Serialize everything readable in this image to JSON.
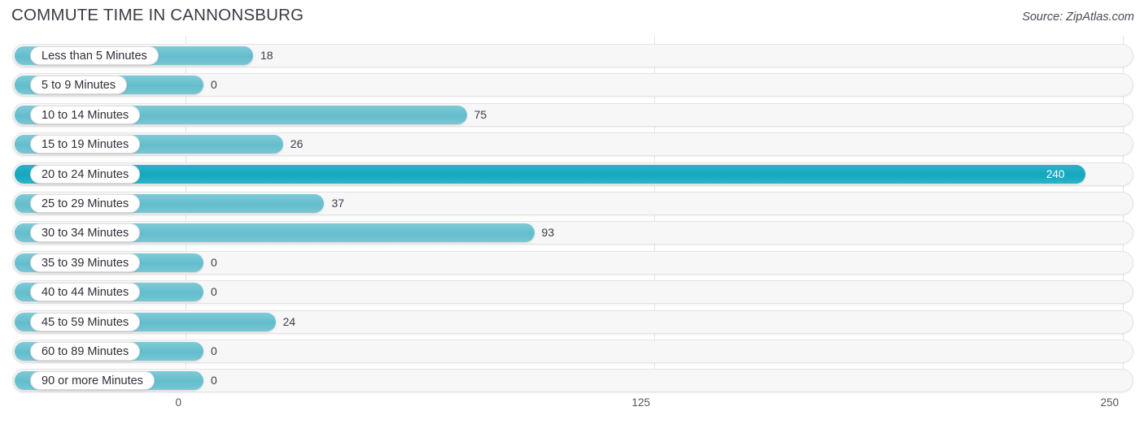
{
  "header": {
    "title": "COMMUTE TIME IN CANNONSBURG",
    "source": "Source: ZipAtlas.com"
  },
  "colors": {
    "bar": "#63bdcd",
    "bar_highlight": "#17a6be",
    "track": "#f7f7f8",
    "grid": "#e3e3e6",
    "text": "#3b3b47"
  },
  "chart_data": {
    "type": "bar",
    "orientation": "horizontal",
    "title": "COMMUTE TIME IN CANNONSBURG",
    "xlabel": "",
    "ylabel": "",
    "xlim": [
      0,
      250
    ],
    "grid": true,
    "legend": null,
    "source": "Source: ZipAtlas.com",
    "tick_labels": [
      "0",
      "125",
      "250"
    ],
    "ticks": [
      0,
      125,
      250
    ],
    "highlight_index": 4,
    "categories": [
      "Less than 5 Minutes",
      "5 to 9 Minutes",
      "10 to 14 Minutes",
      "15 to 19 Minutes",
      "20 to 24 Minutes",
      "25 to 29 Minutes",
      "30 to 34 Minutes",
      "35 to 39 Minutes",
      "40 to 44 Minutes",
      "45 to 59 Minutes",
      "60 to 89 Minutes",
      "90 or more Minutes"
    ],
    "values": [
      18,
      0,
      75,
      26,
      240,
      37,
      93,
      0,
      0,
      24,
      0,
      0
    ],
    "value_labels": [
      "18",
      "0",
      "75",
      "26",
      "240",
      "37",
      "93",
      "0",
      "0",
      "24",
      "0",
      "0"
    ]
  }
}
